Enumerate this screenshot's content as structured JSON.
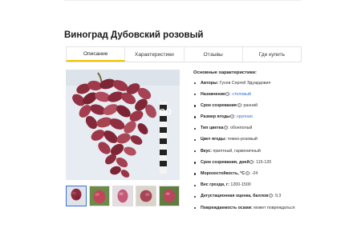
{
  "page": {
    "title": "Виноград Дубовский розовый"
  },
  "tabs": [
    {
      "label": "Описание",
      "active": true
    },
    {
      "label": "Характеристики",
      "active": false
    },
    {
      "label": "Отзывы",
      "active": false
    },
    {
      "label": "Где купить",
      "active": false
    }
  ],
  "gallery": {
    "watermark": "GO",
    "thumbnails": 5,
    "selected_index": 0
  },
  "specs": {
    "heading": "Основные характеристики:",
    "rows": [
      {
        "key": "Авторы:",
        "value": "Гусев Сергей Эдуардович",
        "help": false,
        "link": false
      },
      {
        "key": "Назначение",
        "value": "столовый",
        "help": true,
        "link": true
      },
      {
        "key": "Срок созревания",
        "value": "ранний",
        "help": true,
        "link": false
      },
      {
        "key": "Размер ягоды",
        "value": "крупная",
        "help": true,
        "link": true
      },
      {
        "key": "Тип цветка",
        "value": "обоеполый",
        "help": true,
        "link": false
      },
      {
        "key": "Цвет ягоды:",
        "value": "темно-розовый",
        "help": false,
        "link": false
      },
      {
        "key": "Вкус:",
        "value": "приятный, гармоничный",
        "help": false,
        "link": false
      },
      {
        "key": "Срок созревания, дней",
        "value": "115-120",
        "help": true,
        "link": false
      },
      {
        "key": "Морозостойкость, °C",
        "value": "-24",
        "help": true,
        "link": false
      },
      {
        "key": "Вес грозди, г:",
        "value": "1200-1500",
        "help": false,
        "link": false
      },
      {
        "key": "Дегустационная оценка, баллов",
        "value": "9,3",
        "help": true,
        "link": false
      },
      {
        "key": "Повреждаемость осами:",
        "value": "может повреждаться",
        "help": false,
        "link": false
      }
    ]
  },
  "colors": {
    "tab_active": "#f2c200",
    "link": "#2a6fcf",
    "thumb_selected": "#3b6fd8"
  }
}
